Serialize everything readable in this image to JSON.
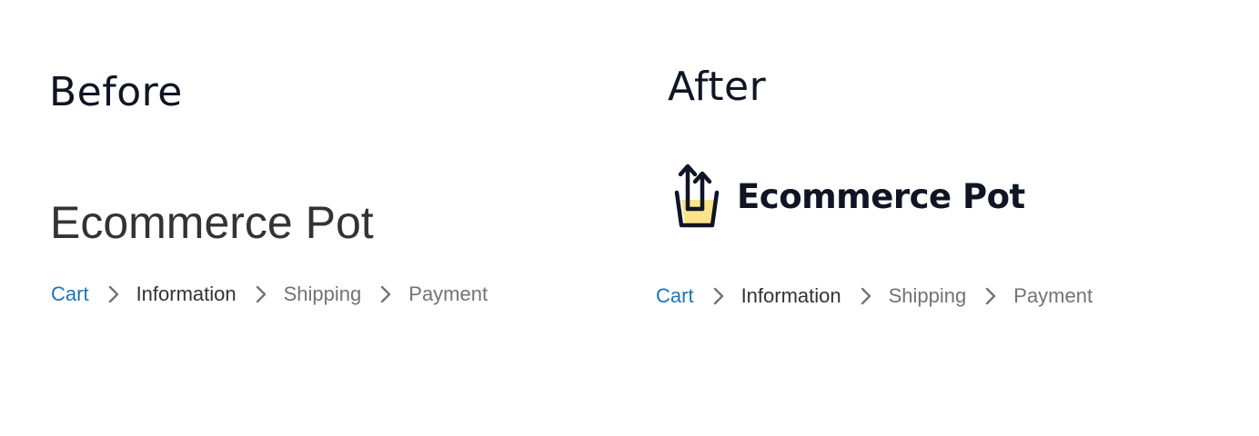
{
  "before": {
    "heading": "Before",
    "store_name": "Ecommerce Pot",
    "breadcrumb": {
      "items": [
        {
          "label": "Cart",
          "state": "link"
        },
        {
          "label": "Information",
          "state": "current"
        },
        {
          "label": "Shipping",
          "state": "upcoming"
        },
        {
          "label": "Payment",
          "state": "upcoming"
        }
      ]
    }
  },
  "after": {
    "heading": "After",
    "logo": {
      "text": "Ecommerce Pot",
      "icon": "pot-with-arrows-icon"
    },
    "breadcrumb": {
      "items": [
        {
          "label": "Cart",
          "state": "link"
        },
        {
          "label": "Information",
          "state": "current"
        },
        {
          "label": "Shipping",
          "state": "upcoming"
        },
        {
          "label": "Payment",
          "state": "upcoming"
        }
      ]
    }
  },
  "colors": {
    "heading": "#0f1524",
    "link": "#1f74b3",
    "current": "#333333",
    "upcoming": "#737373",
    "logo_fill": "#fbe38e",
    "chevron": "#737373"
  }
}
